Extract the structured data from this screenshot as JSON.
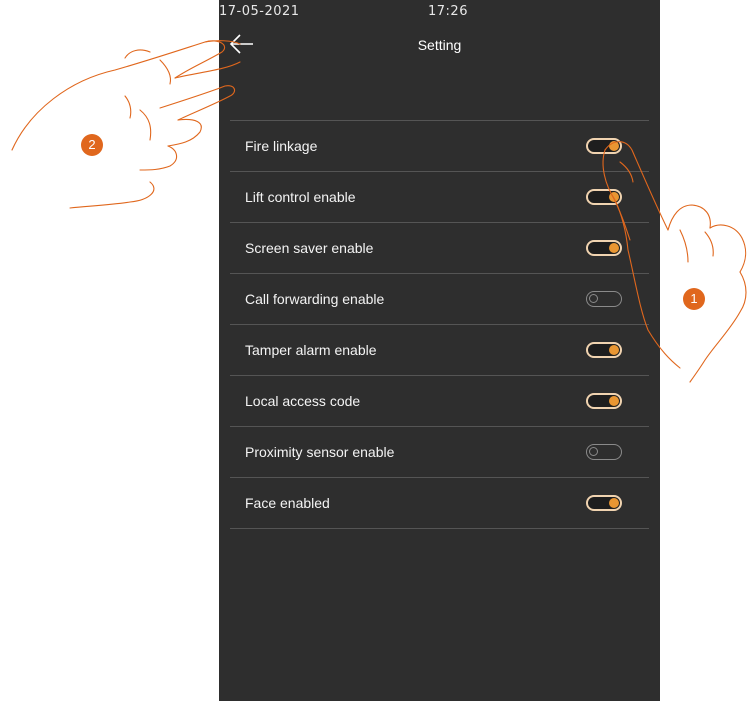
{
  "status_bar": {
    "date": "17-05-2021",
    "time": "17:26"
  },
  "header": {
    "title": "Setting",
    "back_icon": "arrow-left-icon"
  },
  "settings": [
    {
      "label": "Fire linkage",
      "enabled": true
    },
    {
      "label": "Lift control enable",
      "enabled": true
    },
    {
      "label": "Screen saver enable",
      "enabled": true
    },
    {
      "label": "Call forwarding enable",
      "enabled": false
    },
    {
      "label": "Tamper alarm enable",
      "enabled": true
    },
    {
      "label": "Local access code",
      "enabled": true
    },
    {
      "label": "Proximity sensor enable",
      "enabled": false
    },
    {
      "label": "Face enabled",
      "enabled": true
    }
  ],
  "callouts": {
    "step_1": "1",
    "step_2": "2"
  },
  "colors": {
    "screen_background": "#2e2e2e",
    "toggle_on_knob": "#e99632",
    "toggle_on_border": "#f0d3b0",
    "toggle_off": "#8a8a8a",
    "callout": "#e0671d"
  }
}
